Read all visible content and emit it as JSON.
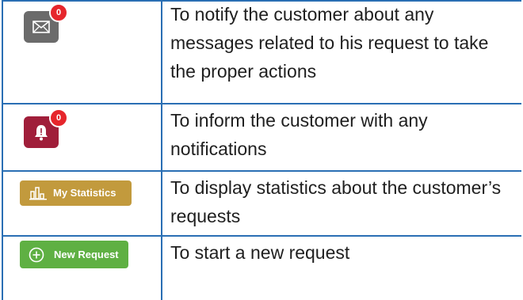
{
  "rows": [
    {
      "icon": "envelope-icon",
      "badge": "0",
      "description": "To notify the customer about any messages related to his request to take the proper actions",
      "color": "#6b6b6b"
    },
    {
      "icon": "bell-icon",
      "badge": "0",
      "description": "To inform the customer with any notifications",
      "color": "#a01e3a"
    },
    {
      "icon": "bar-chart-icon",
      "button_label": "My Statistics",
      "description": "To display statistics about the customer’s requests",
      "color": "#c29a3d"
    },
    {
      "icon": "plus-circle-icon",
      "button_label": "New Request",
      "description": "To start a new request",
      "color": "#5fb043"
    }
  ],
  "colors": {
    "border": "#2a6fb4",
    "badge": "#e6262c",
    "text": "#1f1f1f"
  }
}
